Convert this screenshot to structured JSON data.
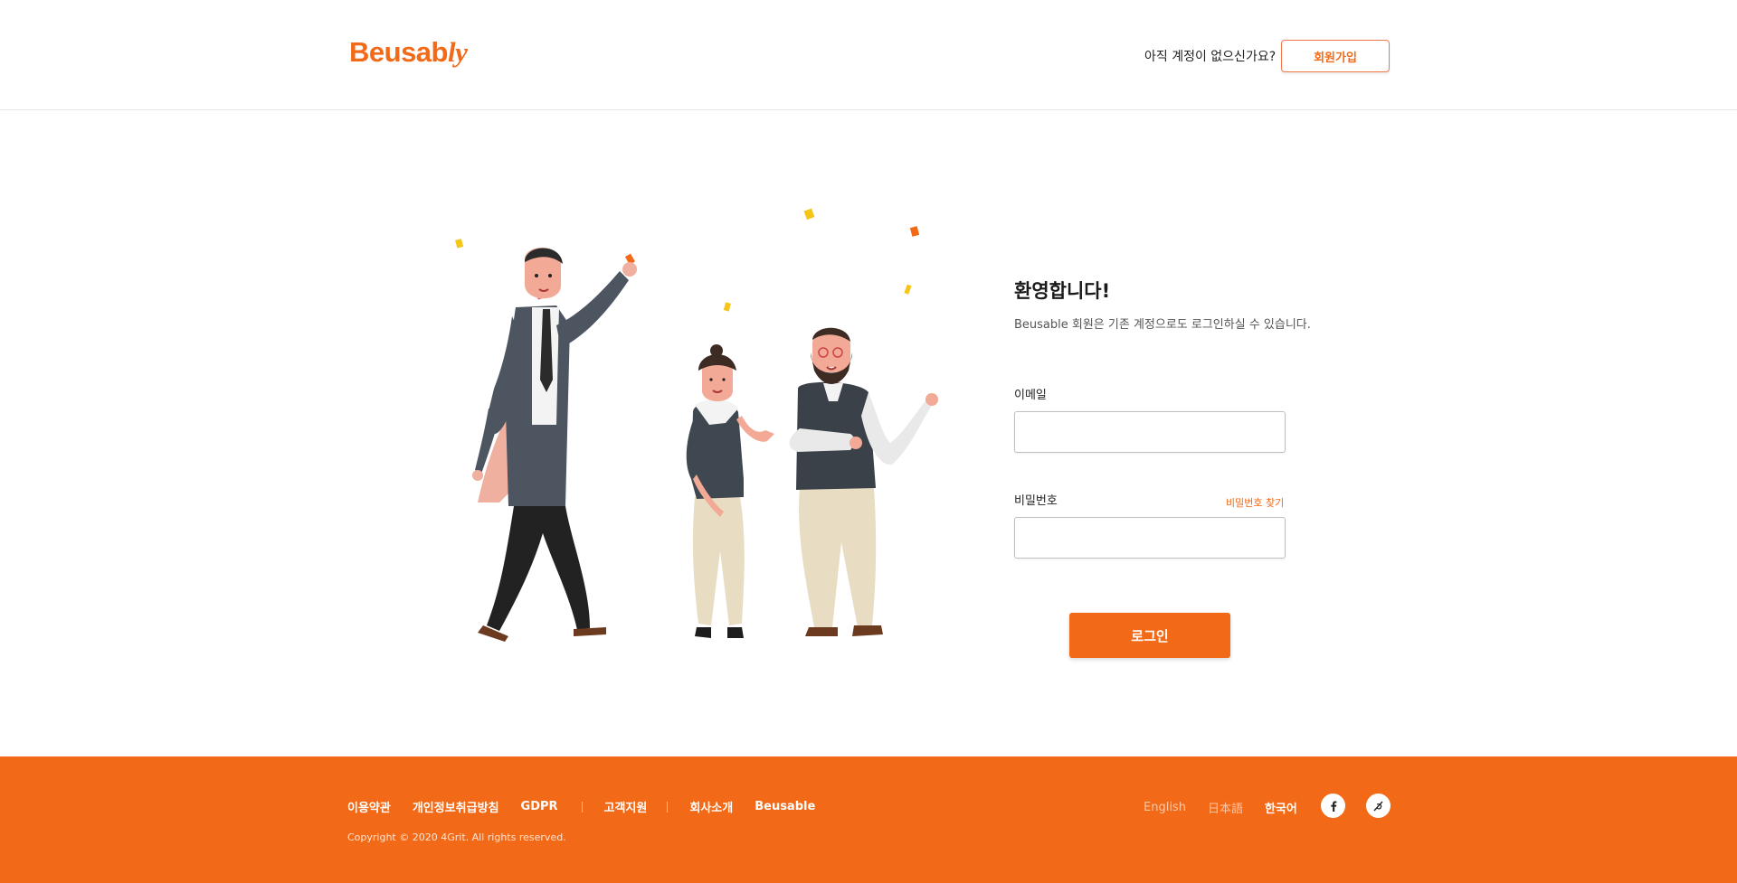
{
  "header": {
    "logo_text": "Beusab",
    "logo_italic": "ly",
    "question": "아직 계정이 없으신가요?",
    "signup_label": "회원가입"
  },
  "main": {
    "welcome": "환영합니다!",
    "subtitle": "Beusable 회원은 기존 계정으로도 로그인하실 수 있습니다.",
    "email_label": "이메일",
    "email_value": "",
    "password_label": "비밀번호",
    "password_value": "",
    "forgot_password": "비밀번호 찾기",
    "login_label": "로그인"
  },
  "footer": {
    "links": [
      "이용약관",
      "개인정보취급방침",
      "GDPR",
      "고객지원",
      "회사소개",
      "Beusable"
    ],
    "copyright": "Copyright © 2020 4Grit. All rights reserved.",
    "languages": {
      "english": "English",
      "japanese": "日本語",
      "korean": "한국어",
      "selected": "한국어"
    },
    "social": [
      "facebook-icon",
      "brunch-icon"
    ]
  },
  "colors": {
    "brand": "#f26a18",
    "footer_bg": "#f26a18"
  }
}
